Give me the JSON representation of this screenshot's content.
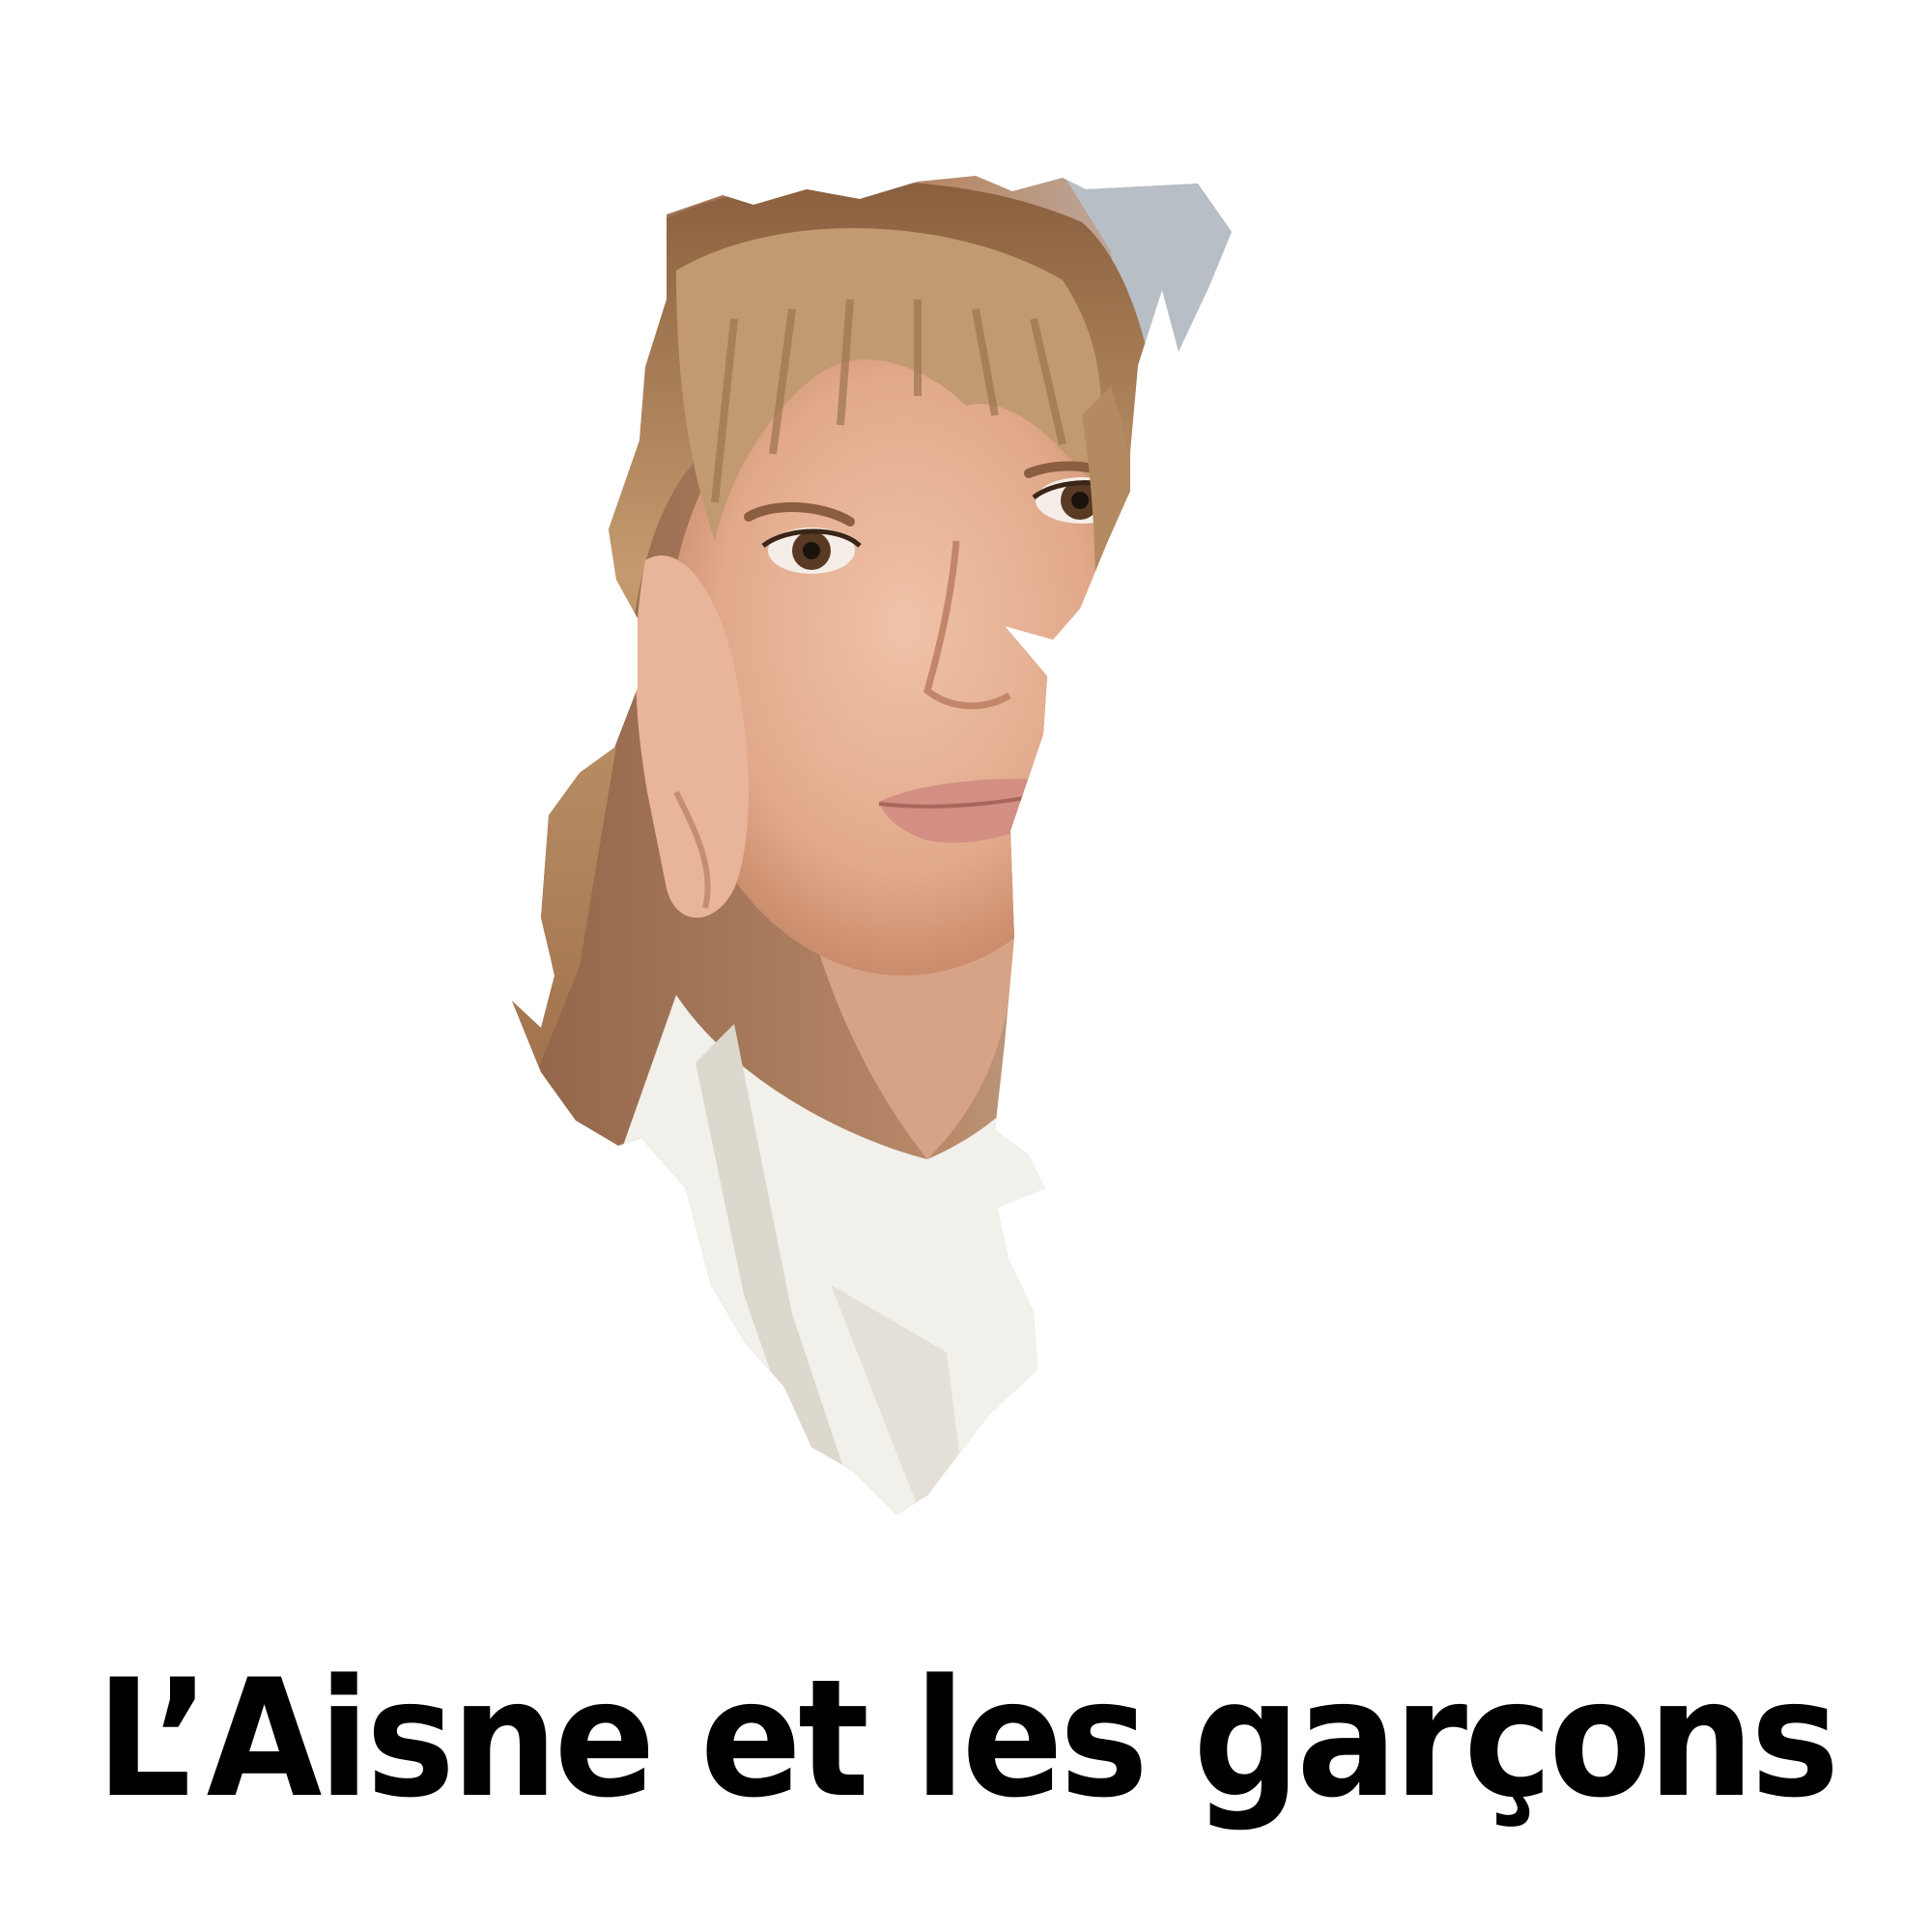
{
  "caption": {
    "text": "L’Aisne et les garçons"
  },
  "image": {
    "subject": "portrait-in-map-shape-cutout",
    "colors": {
      "background": "#ffffff",
      "caption_text": "#000000",
      "hair": "#b58a62",
      "skin": "#e6b59b",
      "shirt": "#f2f0ea",
      "backdrop_left": "#9b6f52",
      "backdrop_right": "#b9c0c8"
    }
  }
}
